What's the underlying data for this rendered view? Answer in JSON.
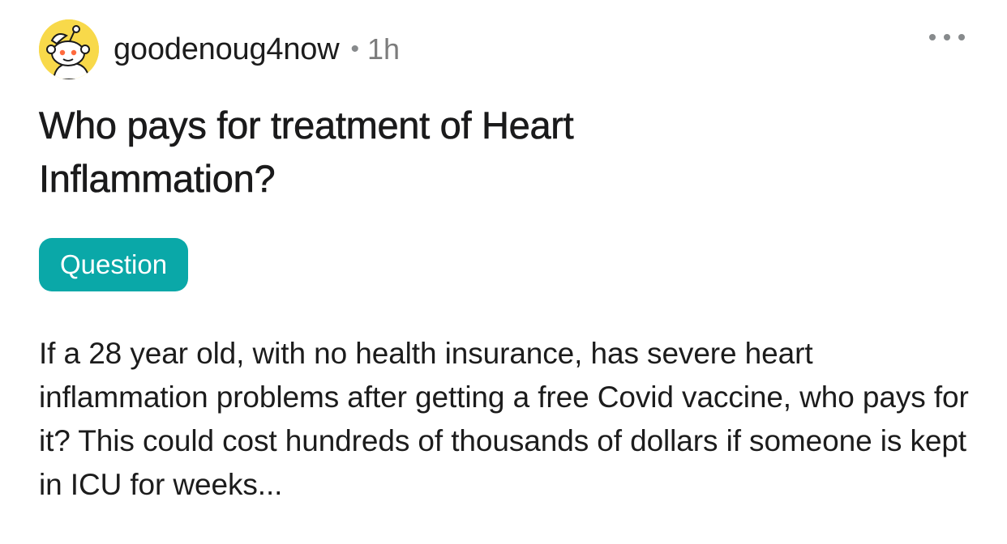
{
  "post": {
    "author": "goodenoug4now",
    "separator": "•",
    "time_ago": "1h",
    "title": "Who pays for treatment of Heart Inflammation?",
    "flair": "Question",
    "body": "If a 28 year old, with no health insurance, has severe heart inflammation problems after getting a free Covid vaccine, who pays for it? This could cost hundreds of thousands of dollars if someone is kept in ICU for weeks...",
    "more_icon": "more-options-icon",
    "avatar_icon": "snoo-avatar-icon"
  },
  "colors": {
    "avatar_bg": "#f8d94a",
    "flair_bg": "#0aa8a8",
    "meta_gray": "#7c7c7c"
  }
}
